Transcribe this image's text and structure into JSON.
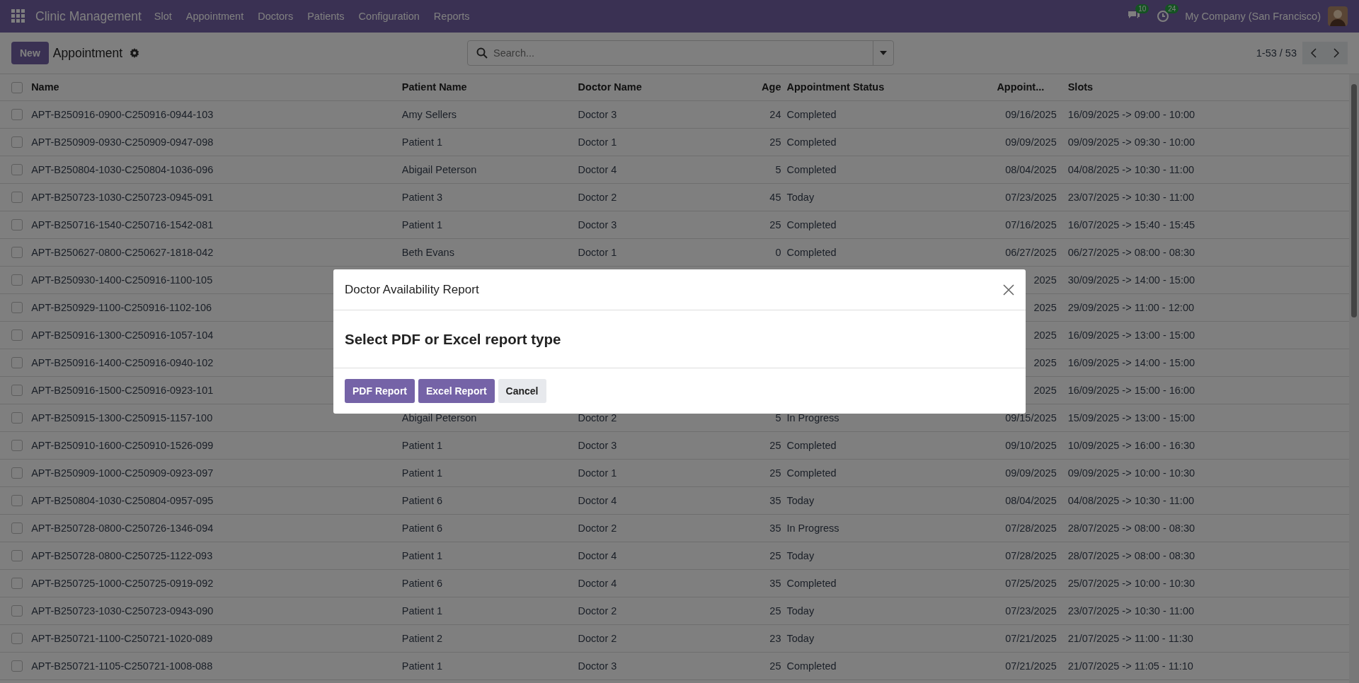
{
  "navbar": {
    "app_name": "Clinic Management",
    "menu": [
      "Slot",
      "Appointment",
      "Doctors",
      "Patients",
      "Configuration",
      "Reports"
    ],
    "messages_count": "10",
    "activities_count": "24",
    "company": "My Company (San Francisco)"
  },
  "control_panel": {
    "new_button": "New",
    "title": "Appointment",
    "search": {
      "placeholder": "Search..."
    },
    "pager": "1-53 / 53"
  },
  "table": {
    "header_checked": false,
    "columns": [
      "Name",
      "Patient Name",
      "Doctor Name",
      "Age",
      "Appointment Status",
      "Appoint...",
      "Slots"
    ],
    "rows": [
      {
        "checked": false,
        "name": "APT-B250916-0900-C250916-0944-103",
        "patient": "Amy Sellers",
        "doctor": "Doctor 3",
        "age": "24",
        "status": "Completed",
        "date": "09/16/2025",
        "slot": "16/09/2025 -> 09:00 - 10:00"
      },
      {
        "checked": false,
        "name": "APT-B250909-0930-C250909-0947-098",
        "patient": "Patient 1",
        "doctor": "Doctor 1",
        "age": "25",
        "status": "Completed",
        "date": "09/09/2025",
        "slot": "09/09/2025 -> 09:30 - 10:00"
      },
      {
        "checked": false,
        "name": "APT-B250804-1030-C250804-1036-096",
        "patient": "Abigail Peterson",
        "doctor": "Doctor 4",
        "age": "5",
        "status": "Completed",
        "date": "08/04/2025",
        "slot": "04/08/2025 -> 10:30 - 11:00"
      },
      {
        "checked": false,
        "name": "APT-B250723-1030-C250723-0945-091",
        "patient": "Patient 3",
        "doctor": "Doctor 2",
        "age": "45",
        "status": "Today",
        "date": "07/23/2025",
        "slot": "23/07/2025 -> 10:30 - 11:00"
      },
      {
        "checked": false,
        "name": "APT-B250716-1540-C250716-1542-081",
        "patient": "Patient 1",
        "doctor": "Doctor 3",
        "age": "25",
        "status": "Completed",
        "date": "07/16/2025",
        "slot": "16/07/2025 -> 15:40 - 15:45"
      },
      {
        "checked": false,
        "name": "APT-B250627-0800-C250627-1818-042",
        "patient": "Beth Evans",
        "doctor": "Doctor 1",
        "age": "0",
        "status": "Completed",
        "date": "06/27/2025",
        "slot": "06/27/2025 -> 08:00 - 08:30"
      },
      {
        "checked": false,
        "name": "APT-B250930-1400-C250916-1100-105",
        "date": "2025",
        "slot": "30/09/2025 -> 14:00 - 15:00"
      },
      {
        "checked": false,
        "name": "APT-B250929-1100-C250916-1102-106",
        "date": "2025",
        "slot": "29/09/2025 -> 11:00 - 12:00"
      },
      {
        "checked": false,
        "name": "APT-B250916-1300-C250916-1057-104",
        "date": "2025",
        "slot": "16/09/2025 -> 13:00 - 15:00"
      },
      {
        "checked": false,
        "name": "APT-B250916-1400-C250916-0940-102",
        "date": "2025",
        "slot": "16/09/2025 -> 14:00 - 15:00"
      },
      {
        "checked": false,
        "name": "APT-B250916-1500-C250916-0923-101",
        "date": "2025",
        "slot": "16/09/2025 -> 15:00 - 16:00"
      },
      {
        "checked": false,
        "name": "APT-B250915-1300-C250915-1157-100",
        "patient": "Abigail Peterson",
        "doctor": "Doctor 2",
        "age": "5",
        "status": "In Progress",
        "date": "09/15/2025",
        "slot": "15/09/2025 -> 13:00 - 15:00"
      },
      {
        "checked": false,
        "name": "APT-B250910-1600-C250910-1526-099",
        "patient": "Patient 1",
        "doctor": "Doctor 3",
        "age": "25",
        "status": "Completed",
        "date": "09/10/2025",
        "slot": "10/09/2025 -> 16:00 - 16:30"
      },
      {
        "checked": false,
        "name": "APT-B250909-1000-C250909-0923-097",
        "patient": "Patient 1",
        "doctor": "Doctor 1",
        "age": "25",
        "status": "Completed",
        "date": "09/09/2025",
        "slot": "09/09/2025 -> 10:00 - 10:30"
      },
      {
        "checked": false,
        "name": "APT-B250804-1030-C250804-0957-095",
        "patient": "Patient 6",
        "doctor": "Doctor 4",
        "age": "35",
        "status": "Today",
        "date": "08/04/2025",
        "slot": "04/08/2025 -> 10:30 - 11:00"
      },
      {
        "checked": false,
        "name": "APT-B250728-0800-C250726-1346-094",
        "patient": "Patient 6",
        "doctor": "Doctor 2",
        "age": "35",
        "status": "In Progress",
        "date": "07/28/2025",
        "slot": "28/07/2025 -> 08:00 - 08:30"
      },
      {
        "checked": false,
        "name": "APT-B250728-0800-C250725-1122-093",
        "patient": "Patient 1",
        "doctor": "Doctor 4",
        "age": "25",
        "status": "Today",
        "date": "07/28/2025",
        "slot": "28/07/2025 -> 08:00 - 08:30"
      },
      {
        "checked": false,
        "name": "APT-B250725-1000-C250725-0919-092",
        "patient": "Patient 6",
        "doctor": "Doctor 4",
        "age": "35",
        "status": "Completed",
        "date": "07/25/2025",
        "slot": "25/07/2025 -> 10:00 - 10:30"
      },
      {
        "checked": false,
        "name": "APT-B250723-1030-C250723-0943-090",
        "patient": "Patient 1",
        "doctor": "Doctor 2",
        "age": "25",
        "status": "Today",
        "date": "07/23/2025",
        "slot": "23/07/2025 -> 10:30 - 11:00"
      },
      {
        "checked": false,
        "name": "APT-B250721-1100-C250721-1020-089",
        "patient": "Patient 2",
        "doctor": "Doctor 2",
        "age": "23",
        "status": "Today",
        "date": "07/21/2025",
        "slot": "21/07/2025 -> 11:00 - 11:30"
      },
      {
        "checked": false,
        "name": "APT-B250721-1105-C250721-1008-088",
        "patient": "Patient 1",
        "doctor": "Doctor 3",
        "age": "25",
        "status": "Completed",
        "date": "07/21/2025",
        "slot": "21/07/2025 -> 11:05 - 11:10"
      }
    ]
  },
  "dialog": {
    "title": "Doctor Availability Report",
    "message": "Select PDF or Excel report type",
    "buttons": [
      {
        "label": "PDF Report",
        "kind": "primary"
      },
      {
        "label": "Excel Report",
        "kind": "primary"
      },
      {
        "label": "Cancel",
        "kind": "secondary"
      }
    ]
  }
}
